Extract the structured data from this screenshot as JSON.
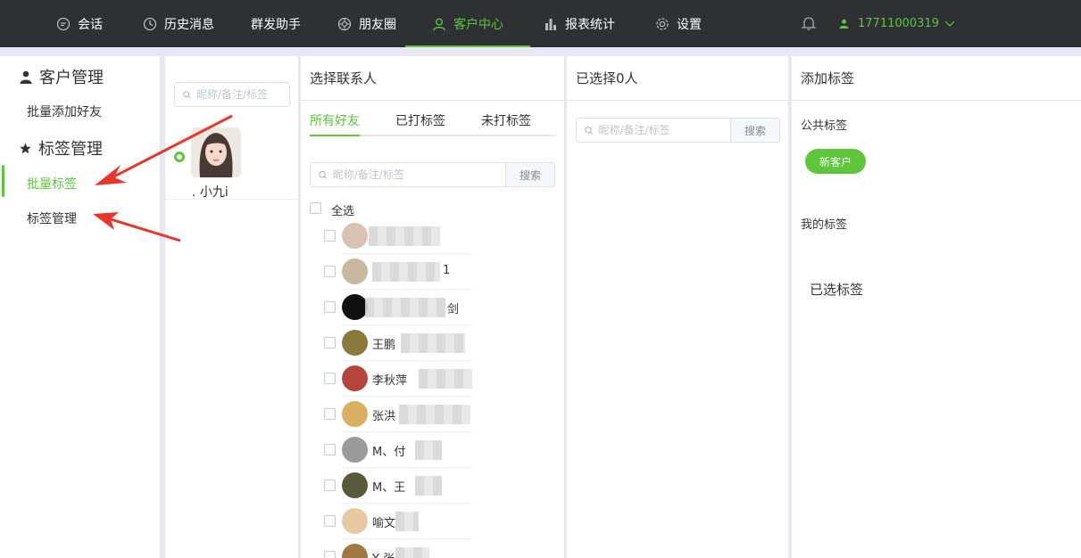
{
  "nav": {
    "items": [
      {
        "label": "会话",
        "icon": "chat-icon"
      },
      {
        "label": "历史消息",
        "icon": "clock-icon"
      },
      {
        "label": "群发助手",
        "icon": ""
      },
      {
        "label": "朋友圈",
        "icon": "aperture-icon"
      },
      {
        "label": "客户中心",
        "icon": "user-icon"
      },
      {
        "label": "报表统计",
        "icon": "bar-chart-icon"
      },
      {
        "label": "设置",
        "icon": "gear-icon"
      }
    ],
    "active": "客户中心",
    "user_phone": "17711000319",
    "accent": "#5dc63a"
  },
  "sidebar": {
    "section1": "客户管理",
    "item1": "批量添加好友",
    "section2": "标签管理",
    "item2": "批量标签",
    "item3": "标签管理"
  },
  "account": {
    "search_placeholder": "昵称/备注/标签",
    "name": ". 小九i"
  },
  "contacts": {
    "header": "选择联系人",
    "tabs": [
      "所有好友",
      "已打标签",
      "未打标签"
    ],
    "search_placeholder": "昵称/备注/标签",
    "search_button": "搜索",
    "select_all": "全选",
    "rows": [
      {
        "name": ""
      },
      {
        "name": "1"
      },
      {
        "name": "剑"
      },
      {
        "name": "王鹏"
      },
      {
        "name": "李秋萍"
      },
      {
        "name": "张洪"
      },
      {
        "name": "M、付"
      },
      {
        "name": "M、王"
      },
      {
        "name": "喻文"
      },
      {
        "name": "Y 张"
      }
    ]
  },
  "selected": {
    "header": "已选择0人",
    "search_placeholder": "昵称/备注/标签",
    "search_button": "搜索"
  },
  "tags": {
    "header": "添加标签",
    "public_label": "公共标签",
    "public_tag": "新客户",
    "my_label": "我的标签",
    "selected_label": "已选标签"
  }
}
